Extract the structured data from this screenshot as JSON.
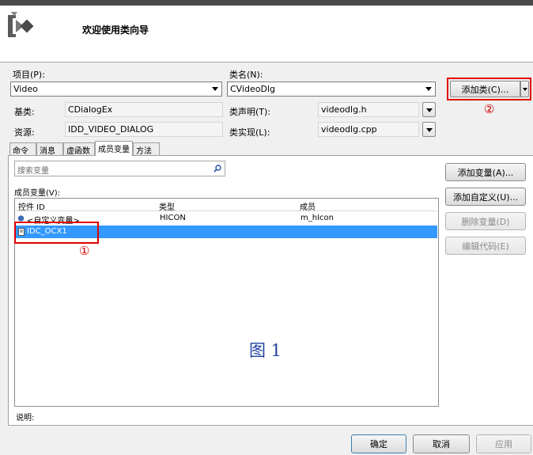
{
  "header": {
    "title": "欢迎使用类向导"
  },
  "form": {
    "project_label": "项目(P):",
    "project_value": "Video",
    "classname_label": "类名(N):",
    "classname_value": "CVideoDlg",
    "add_class_label": "添加类(C)...",
    "base_label": "基类:",
    "base_value": "CDialogEx",
    "decl_label": "类声明(T):",
    "decl_value": "videodlg.h",
    "resource_label": "资源:",
    "resource_value": "IDD_VIDEO_DIALOG",
    "impl_label": "类实现(L):",
    "impl_value": "videodlg.cpp"
  },
  "tabs": [
    "命令",
    "消息",
    "虚函数",
    "成员变量",
    "方法"
  ],
  "active_tab": "成员变量",
  "panel": {
    "search_placeholder": "搜索变量",
    "members_label": "成员变量(V):",
    "columns": [
      "控件 ID",
      "类型",
      "成员"
    ],
    "rows": [
      {
        "id": "<自定义变量>",
        "type": "HICON",
        "member": "m_hIcon"
      },
      {
        "id": "IDC_OCX1",
        "type": "",
        "member": "",
        "selected": true
      }
    ],
    "description_label": "说明:"
  },
  "side_buttons": {
    "add_variable": "添加变量(A)...",
    "add_custom": "添加自定义(U)...",
    "delete_variable": "删除变量(D)",
    "edit_code": "编辑代码(E)"
  },
  "footer": {
    "ok": "确定",
    "cancel": "取消",
    "apply": "应用"
  },
  "annotations": {
    "circle1": "①",
    "circle2": "②",
    "figure_caption": "图 1"
  },
  "colors": {
    "selection": "#3399ff",
    "annotation_red": "#e00000",
    "caption_blue": "#1f3f9f"
  }
}
